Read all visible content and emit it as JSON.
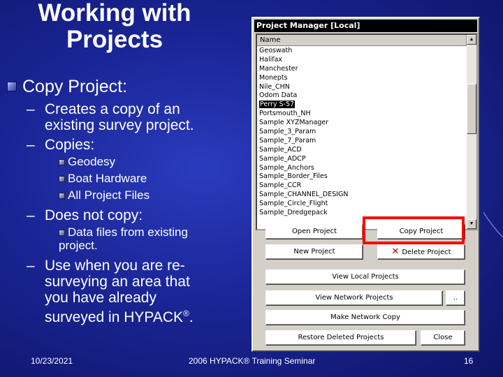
{
  "slide": {
    "title_line1": "Working with",
    "title_line2": "Projects",
    "bullet1": "Copy Project:",
    "sub1_line1": "Creates a copy of an",
    "sub1_line2": "existing survey project.",
    "sub2": "Copies:",
    "copies_items": [
      "Geodesy",
      "Boat Hardware",
      "All Project Files"
    ],
    "sub3": "Does not copy:",
    "notcopy_line1": "Data files from existing",
    "notcopy_line2": "project.",
    "sub4_line1": "Use when you are re-",
    "sub4_line2": "surveying an area that",
    "sub4_line3": "you have already",
    "sub4_line4": "surveyed in HYPACK",
    "sub4_reg": "®",
    "sub4_end": ".",
    "dash": "–"
  },
  "footer": {
    "date": "10/23/2021",
    "seminar": "2006 HYPACK® Training Seminar",
    "page": "16"
  },
  "dialog": {
    "title": "Project Manager [Local]",
    "list_header": "Name",
    "projects": [
      "Geoswath",
      "Halifax",
      "Manchester",
      "Monepts",
      "Nile_CHN",
      "Odom Data",
      "Perry S-57",
      "Portsmouth_NH",
      "Sample XYZManager",
      "Sample_3_Param",
      "Sample_7_Param",
      "Sample_ACD",
      "Sample_ADCP",
      "Sample_Anchors",
      "Sample_Border_Files",
      "Sample_CCR",
      "Sample_CHANNEL_DESIGN",
      "Sample_Circle_Flight",
      "Sample_Dredgepack"
    ],
    "selected_project": "Perry S-57",
    "scroll_up": "▲",
    "scroll_down": "▼",
    "buttons": {
      "open_project": "Open Project",
      "copy_project": "Copy Project",
      "new_project": "New Project",
      "delete_project": "Delete Project",
      "delete_mark": "✕",
      "view_local": "View Local Projects",
      "view_network": "View Network Projects",
      "browse": "..",
      "make_network_copy": "Make Network Copy",
      "restore_deleted": "Restore Deleted Projects",
      "close": "Close"
    }
  },
  "colors": {
    "background": "#1a2596",
    "highlight": "#ff0000",
    "dialog_face": "#d4d0c8"
  }
}
